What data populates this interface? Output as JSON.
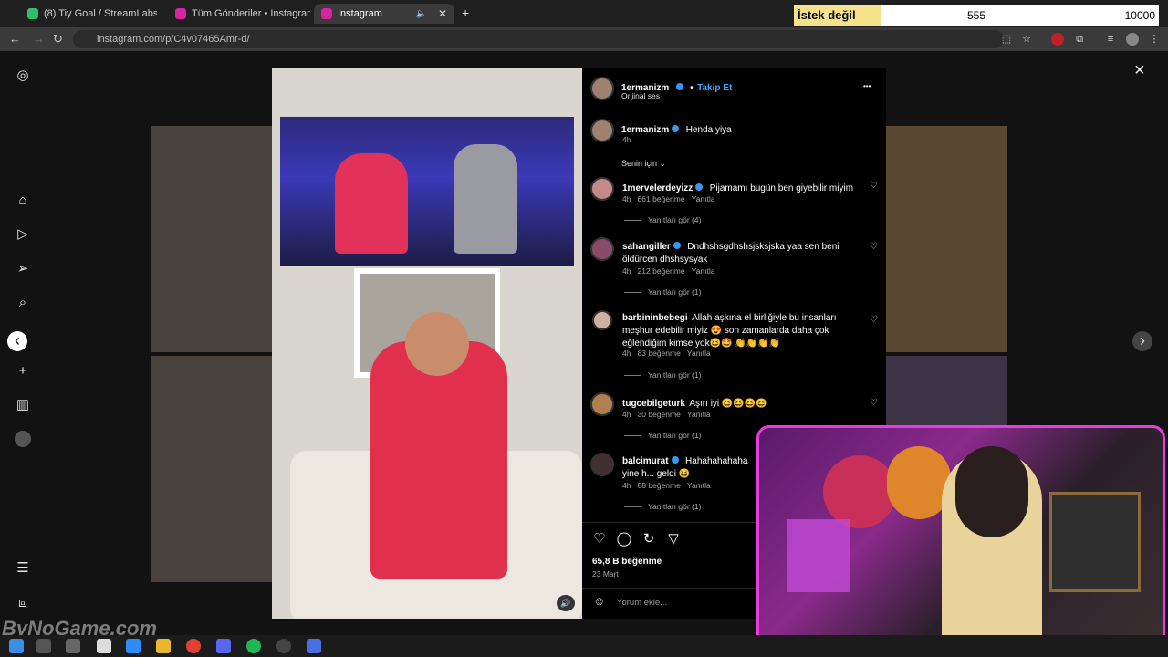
{
  "browser": {
    "tabs": [
      {
        "label": "(8) Tiy Goal / StreamLabs",
        "active": false
      },
      {
        "label": "Tüm Gönderiler • Instagram",
        "active": false
      },
      {
        "label": "Instagram",
        "active": true
      }
    ],
    "url": "instagram.com/p/C4v07465Amr-d/"
  },
  "overlay": {
    "label": "İstek değil ihtiyaç",
    "current": "555",
    "goal": "10000"
  },
  "post": {
    "author": "1ermanizm",
    "follow_label": "Takip Et",
    "dot": "•",
    "audio": "Orijinal ses",
    "caption_user": "1ermanizm",
    "caption_text": "Henda yiya",
    "caption_time": "4h",
    "sort_label": "Senin için",
    "likes": "65,8 B beğenme",
    "date": "23 Mart",
    "comment_placeholder": "Yorum ekle..."
  },
  "comments": [
    {
      "user": "1mervelerdeyizz",
      "text": "Pijamamı bugün ben giyebilir miyim",
      "time": "4h",
      "likes": "661 beğenme",
      "reply": "Yanıtla",
      "replies": "Yanıtları gör (4)"
    },
    {
      "user": "sahangiller",
      "text": "Dndhshsgdhshsjsksjska yaa sen beni öldürcen dhshsysyak",
      "time": "4h",
      "likes": "212 beğenme",
      "reply": "Yanıtla",
      "replies": "Yanıtları gör (1)"
    },
    {
      "user": "barbininbebegi",
      "text": "Allah aşkına el birliğiyle bu insanları meşhur edebilir miyiz 😍 son zamanlarda daha çok eğlendiğim kimse yok😆🤩 👏👏👏👏",
      "time": "4h",
      "likes": "83 beğenme",
      "reply": "Yanıtla",
      "replies": "Yanıtları gör (1)"
    },
    {
      "user": "tugcebilgeturk",
      "text": "Aşırı iyi 😆😆😆😆",
      "time": "4h",
      "likes": "30 beğenme",
      "reply": "Yanıtla",
      "replies": "Yanıtları gör (1)"
    },
    {
      "user": "balcimurat",
      "text": "Hahahahahaha yine h... geldi 😆",
      "time": "4h",
      "likes": "88 beğenme",
      "reply": "Yanıtla",
      "replies": "Yanıtları gör (1)"
    }
  ],
  "watermark": "ByNoGame.com",
  "icons": {
    "close": "×",
    "next": "›",
    "prev": "‹",
    "more": "•••",
    "heart": "♡",
    "volume": "🔊"
  }
}
